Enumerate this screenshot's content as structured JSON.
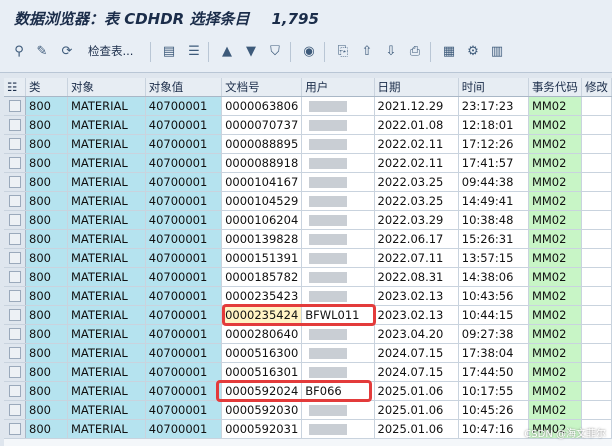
{
  "header": {
    "title": "数据浏览器：表 CDHDR 选择条目",
    "count": "1,795"
  },
  "toolbar": {
    "check_label": "检查表...",
    "icons": [
      "glasses-icon",
      "edit-icon",
      "refresh-icon",
      "filter-first-icon",
      "list-icon",
      "sort-asc-icon",
      "sort-desc-icon",
      "filter-icon",
      "details-icon",
      "export-icon",
      "upload-icon",
      "download-icon",
      "print-icon",
      "layout-grid-icon",
      "settings-grid-icon",
      "chart-icon"
    ]
  },
  "table": {
    "columns": [
      "类",
      "对象",
      "对象值",
      "文档号",
      "用户",
      "日期",
      "时间",
      "事务代码",
      "修改"
    ],
    "rows": [
      {
        "mandt": "800",
        "object": "MATERIAL",
        "objectid": "40700001",
        "changenr": "0000063806",
        "user": "",
        "date": "2021.12.29",
        "time": "23:17:23",
        "tcode": "MM02"
      },
      {
        "mandt": "800",
        "object": "MATERIAL",
        "objectid": "40700001",
        "changenr": "0000070737",
        "user": "",
        "date": "2022.01.08",
        "time": "12:18:01",
        "tcode": "MM02"
      },
      {
        "mandt": "800",
        "object": "MATERIAL",
        "objectid": "40700001",
        "changenr": "0000088895",
        "user": "",
        "date": "2022.02.11",
        "time": "17:12:26",
        "tcode": "MM02"
      },
      {
        "mandt": "800",
        "object": "MATERIAL",
        "objectid": "40700001",
        "changenr": "0000088918",
        "user": "",
        "date": "2022.02.11",
        "time": "17:41:57",
        "tcode": "MM02"
      },
      {
        "mandt": "800",
        "object": "MATERIAL",
        "objectid": "40700001",
        "changenr": "0000104167",
        "user": "",
        "date": "2022.03.25",
        "time": "09:44:38",
        "tcode": "MM02"
      },
      {
        "mandt": "800",
        "object": "MATERIAL",
        "objectid": "40700001",
        "changenr": "0000104529",
        "user": "",
        "date": "2022.03.25",
        "time": "14:49:41",
        "tcode": "MM02"
      },
      {
        "mandt": "800",
        "object": "MATERIAL",
        "objectid": "40700001",
        "changenr": "0000106204",
        "user": "",
        "date": "2022.03.29",
        "time": "10:38:48",
        "tcode": "MM02"
      },
      {
        "mandt": "800",
        "object": "MATERIAL",
        "objectid": "40700001",
        "changenr": "0000139828",
        "user": "",
        "date": "2022.06.17",
        "time": "15:26:31",
        "tcode": "MM02"
      },
      {
        "mandt": "800",
        "object": "MATERIAL",
        "objectid": "40700001",
        "changenr": "0000151391",
        "user": "",
        "date": "2022.07.11",
        "time": "13:57:15",
        "tcode": "MM02"
      },
      {
        "mandt": "800",
        "object": "MATERIAL",
        "objectid": "40700001",
        "changenr": "0000185782",
        "user": "",
        "date": "2022.08.31",
        "time": "14:38:06",
        "tcode": "MM02"
      },
      {
        "mandt": "800",
        "object": "MATERIAL",
        "objectid": "40700001",
        "changenr": "0000235423",
        "user": "",
        "date": "2023.02.13",
        "time": "10:43:56",
        "tcode": "MM02"
      },
      {
        "mandt": "800",
        "object": "MATERIAL",
        "objectid": "40700001",
        "changenr": "0000235424",
        "user": "BFWL011",
        "date": "2023.02.13",
        "time": "10:44:15",
        "tcode": "MM02"
      },
      {
        "mandt": "800",
        "object": "MATERIAL",
        "objectid": "40700001",
        "changenr": "0000280640",
        "user": "",
        "date": "2023.04.20",
        "time": "09:27:38",
        "tcode": "MM02"
      },
      {
        "mandt": "800",
        "object": "MATERIAL",
        "objectid": "40700001",
        "changenr": "0000516300",
        "user": "",
        "date": "2024.07.15",
        "time": "17:38:04",
        "tcode": "MM02"
      },
      {
        "mandt": "800",
        "object": "MATERIAL",
        "objectid": "40700001",
        "changenr": "0000516301",
        "user": "",
        "date": "2024.07.15",
        "time": "17:44:50",
        "tcode": "MM02"
      },
      {
        "mandt": "800",
        "object": "MATERIAL",
        "objectid": "40700001",
        "changenr": "0000592024",
        "user": "BF066",
        "date": "2025.01.06",
        "time": "10:17:55",
        "tcode": "MM02"
      },
      {
        "mandt": "800",
        "object": "MATERIAL",
        "objectid": "40700001",
        "changenr": "0000592030",
        "user": "",
        "date": "2025.01.06",
        "time": "10:45:26",
        "tcode": "MM02"
      },
      {
        "mandt": "800",
        "object": "MATERIAL",
        "objectid": "40700001",
        "changenr": "0000592031",
        "user": "",
        "date": "2025.01.06",
        "time": "10:47:16",
        "tcode": "MM02"
      }
    ]
  },
  "colors": {
    "key": "#b5e3ef",
    "tcode": "#c8f5c6",
    "highlight": "#e33b3b"
  },
  "watermark": "CSDN @海文菲尔"
}
